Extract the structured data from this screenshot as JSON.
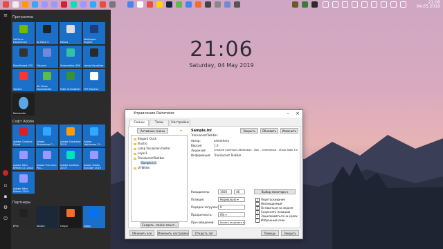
{
  "desktop": {
    "clock_time": "21:06",
    "clock_date": "Saturday, 04 May 2019",
    "tray_time": "21:06",
    "tray_date": "04.05.2019"
  },
  "start_menu": {
    "group1": "Программы",
    "group2": "Софт Adobe",
    "group3": "Партнеры",
    "tiles": [
      {
        "label": "GeForce Experience",
        "color": "#76b900"
      },
      {
        "label": "AI Suite 3",
        "color": "#222222"
      },
      {
        "label": "Nexus",
        "color": "#dddddd"
      },
      {
        "label": "Wallpaper Engine",
        "color": "#1f3c78"
      },
      {
        "label": "MotoSpeed V70",
        "color": "#333333"
      },
      {
        "label": "Discord",
        "color": "#7289da"
      },
      {
        "label": "Streamlabs OBS",
        "color": "#31c3a2"
      },
      {
        "label": "Lamp Visualizer",
        "color": "#2a2a2a"
      },
      {
        "label": "Yandex",
        "color": "#ff3333"
      },
      {
        "label": "4K Video Downloader",
        "color": "#5dbb46"
      },
      {
        "label": "IObit Uninstaller",
        "color": "#3a8f3a"
      },
      {
        "label": "FPS Monitor",
        "color": "#ffffff"
      },
      {
        "label": "Rainmeter",
        "color": "#5aa6e6"
      },
      {
        "label": "Adobe Creative Cloud",
        "color": "#da1f26"
      },
      {
        "label": "Adobe Photoshop C...",
        "color": "#31a8ff"
      },
      {
        "label": "Adobe Illustrator 2019",
        "color": "#ff9a00"
      },
      {
        "label": "Adobe Lightroom Cl...",
        "color": "#31a8ff"
      },
      {
        "label": "Adobe After Effects CC 2018",
        "color": "#9999ff"
      },
      {
        "label": "Adobe Premiere Pro...",
        "color": "#9999ff"
      },
      {
        "label": "Adobe Audition 2019",
        "color": "#00e4bb"
      },
      {
        "label": "Adobe Media Encoder 2019",
        "color": "#9999ff"
      },
      {
        "label": "Adobe After Effects 2019",
        "color": "#9999ff"
      },
      {
        "label": "EPIC",
        "color": "#222222"
      },
      {
        "label": "Steam",
        "color": "#1b2838"
      },
      {
        "label": "Origin",
        "color": "#f56c2d"
      },
      {
        "label": "Uplay",
        "color": "#0070ff"
      }
    ]
  },
  "window": {
    "title": "Управление Rainmeter",
    "tabs": [
      "Скины",
      "Темы",
      "Настройки"
    ],
    "active_skins_label": "Активные скины",
    "tree": [
      "Elegant Clock",
      "illustro",
      "Lamp Visualizer-master",
      "Layer1",
      "TranslucentTaskbar",
      "Sample.ini",
      "UI White"
    ],
    "create_skin_btn": "Создать .rmskin пакет...",
    "skin_name": "Sample.ini",
    "skin_folder": "TranslucentTaskbar",
    "btn_close": "Закрыть",
    "btn_refresh": "Обновить",
    "btn_edit": "Изменить",
    "info_labels": [
      "Автор:",
      "Версия:",
      "Лицензия:",
      "Информация:"
    ],
    "info_values": [
      "arkenthera",
      "1.0",
      "Creative Commons Attribution - Non - Commercial - Share Alike 3.0",
      "Translucent Taskbar"
    ],
    "coords_label": "Координаты:",
    "coord_x": "1920",
    "coord_y": "46",
    "monitor_btn": "Выбор монитора",
    "position_label": "Позиция:",
    "position_value": "Нормально",
    "load_order_label": "Порядок загрузки:",
    "load_order_value": "0",
    "transparency_label": "Прозрачность:",
    "transparency_value": "0%",
    "hover_label": "При наведении:",
    "hover_value": "Ничего не делать",
    "checkboxes": [
      {
        "label": "Перетаскивание",
        "checked": true
      },
      {
        "label": "Несмещаемый",
        "checked": false
      },
      {
        "label": "Оставаться на экране",
        "checked": true
      },
      {
        "label": "Сохранять позицию",
        "checked": true
      },
      {
        "label": "Защелкиваться на краях",
        "checked": true
      },
      {
        "label": "Избранный скин",
        "checked": false
      }
    ],
    "btn_refresh_all": "Обновить все",
    "btn_edit_settings": "Изменить настройки",
    "btn_open_log": "Открыть лог",
    "btn_help": "Помощь",
    "btn_close_bottom": "Закрыть"
  }
}
